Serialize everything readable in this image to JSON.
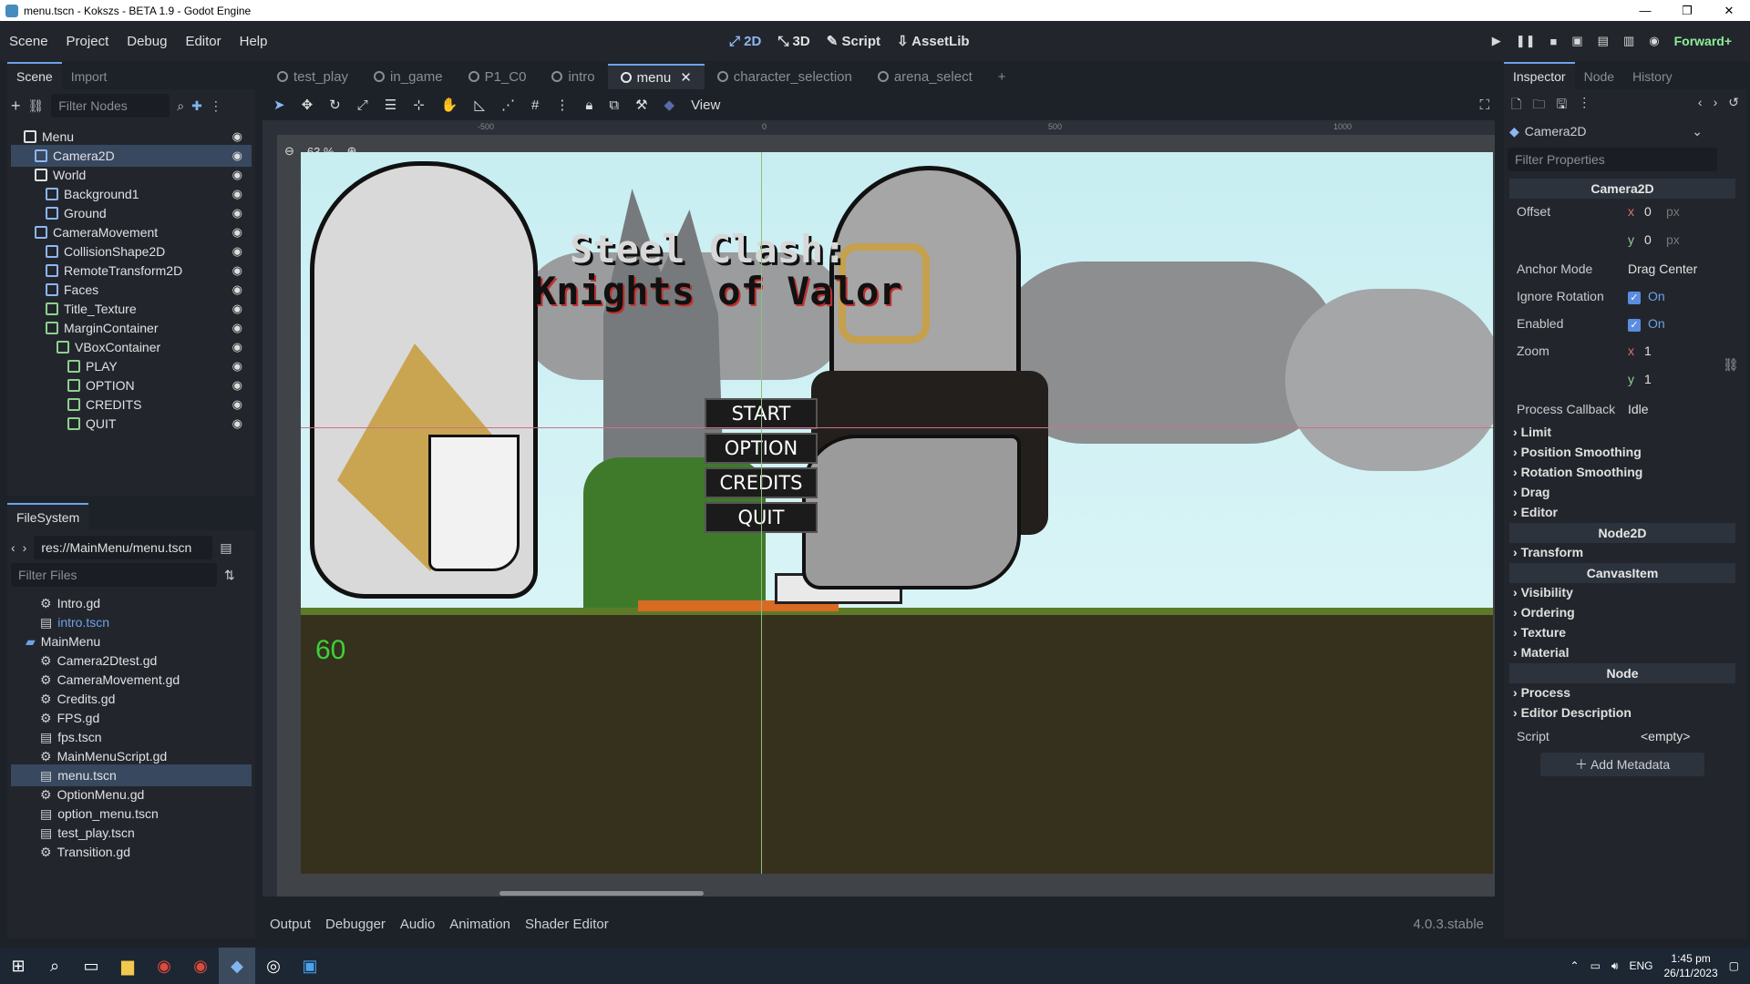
{
  "window": {
    "title": "menu.tscn - Kokszs - BETA 1.9 - Godot Engine",
    "controls": [
      "—",
      "❐",
      "✕"
    ]
  },
  "menubar": {
    "items": [
      "Scene",
      "Project",
      "Debug",
      "Editor",
      "Help"
    ]
  },
  "modes": {
    "m2d": "2D",
    "m3d": "3D",
    "script": "Script",
    "assetlib": "AssetLib"
  },
  "renderer": "Forward+",
  "scene_dock": {
    "tabs": [
      "Scene",
      "Import"
    ],
    "filter_placeholder": "Filter Nodes",
    "nodes": [
      {
        "label": "Menu",
        "indent": 0
      },
      {
        "label": "Camera2D",
        "indent": 1,
        "selected": true
      },
      {
        "label": "World",
        "indent": 1
      },
      {
        "label": "Background1",
        "indent": 2
      },
      {
        "label": "Ground",
        "indent": 2
      },
      {
        "label": "CameraMovement",
        "indent": 1
      },
      {
        "label": "CollisionShape2D",
        "indent": 2
      },
      {
        "label": "RemoteTransform2D",
        "indent": 2
      },
      {
        "label": "Faces",
        "indent": 2
      },
      {
        "label": "Title_Texture",
        "indent": 2
      },
      {
        "label": "MarginContainer",
        "indent": 2
      },
      {
        "label": "VBoxContainer",
        "indent": 3
      },
      {
        "label": "PLAY",
        "indent": 4
      },
      {
        "label": "OPTION",
        "indent": 4
      },
      {
        "label": "CREDITS",
        "indent": 4
      },
      {
        "label": "QUIT",
        "indent": 4
      }
    ]
  },
  "filesystem": {
    "tab": "FileSystem",
    "path": "res://MainMenu/menu.tscn",
    "filter_placeholder": "Filter Files",
    "files": [
      {
        "label": "Intro.gd",
        "indent": 1
      },
      {
        "label": "intro.tscn",
        "indent": 1
      },
      {
        "label": "MainMenu",
        "indent": 0
      },
      {
        "label": "Camera2Dtest.gd",
        "indent": 1
      },
      {
        "label": "CameraMovement.gd",
        "indent": 1
      },
      {
        "label": "Credits.gd",
        "indent": 1
      },
      {
        "label": "FPS.gd",
        "indent": 1
      },
      {
        "label": "fps.tscn",
        "indent": 1
      },
      {
        "label": "MainMenuScript.gd",
        "indent": 1
      },
      {
        "label": "menu.tscn",
        "indent": 1,
        "selected": true
      },
      {
        "label": "OptionMenu.gd",
        "indent": 1
      },
      {
        "label": "option_menu.tscn",
        "indent": 1
      },
      {
        "label": "test_play.tscn",
        "indent": 1
      },
      {
        "label": "Transition.gd",
        "indent": 1
      }
    ]
  },
  "scene_tabs": [
    "test_play",
    "in_game",
    "P1_C0",
    "intro",
    "menu",
    "character_selection",
    "arena_select"
  ],
  "toolbar": {
    "view": "View"
  },
  "viewport": {
    "zoom": "63 %",
    "ruler": [
      "-500",
      "0",
      "500",
      "1000"
    ],
    "title_line1": "Steel Clash:",
    "title_line2": "Knights of Valor",
    "buttons": [
      "START",
      "OPTION",
      "CREDITS",
      "QUIT"
    ],
    "fps": "60"
  },
  "bottom_tabs": [
    "Output",
    "Debugger",
    "Audio",
    "Animation",
    "Shader Editor"
  ],
  "version": "4.0.3.stable",
  "inspector": {
    "tabs": [
      "Inspector",
      "Node",
      "History"
    ],
    "node": "Camera2D",
    "filter_placeholder": "Filter Properties",
    "class_header": "Camera2D",
    "offset_label": "Offset",
    "offset_x": "0",
    "offset_y": "0",
    "px": "px",
    "anchor_mode_label": "Anchor Mode",
    "anchor_mode": "Drag Center",
    "ignore_rotation_label": "Ignore Rotation",
    "enabled_label": "Enabled",
    "on": "On",
    "zoom_label": "Zoom",
    "zoom_x": "1",
    "zoom_y": "1",
    "process_label": "Process Callback",
    "process_value": "Idle",
    "sections1": [
      "Limit",
      "Position Smoothing",
      "Rotation Smoothing",
      "Drag",
      "Editor"
    ],
    "node2d_header": "Node2D",
    "sections2": [
      "Transform"
    ],
    "canvas_header": "CanvasItem",
    "sections3": [
      "Visibility",
      "Ordering",
      "Texture",
      "Material"
    ],
    "node_header": "Node",
    "sections4": [
      "Process",
      "Editor Description"
    ],
    "script_label": "Script",
    "script_value": "<empty>",
    "add_metadata": "Add Metadata"
  },
  "taskbar": {
    "lang": "ENG",
    "time": "1:45 pm",
    "date": "26/11/2023"
  }
}
